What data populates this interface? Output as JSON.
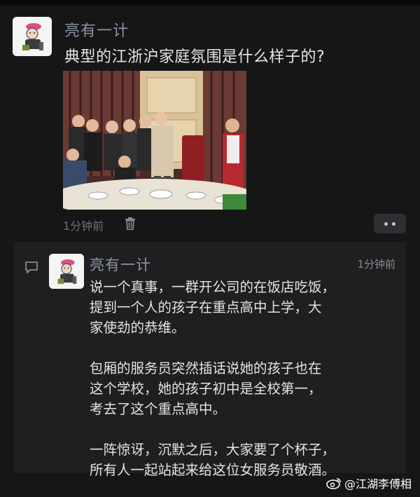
{
  "post": {
    "author": "亮有一计",
    "title": "典型的江浙沪家庭氛围是什么样子的?",
    "time": "1分钟前",
    "photo_alt_icon": "photo-image"
  },
  "reply": {
    "author": "亮有一计",
    "time": "1分钟前",
    "paragraphs": [
      "说一个真事，一群开公司的在饭店吃饭，\n提到一个人的孩子在重点高中上学，大\n家使劲的恭维。",
      "包厢的服务员突然插话说她的孩子也在\n这个学校，她的孩子初中是全校第一，\n考去了这个重点高中。",
      "一阵惊讶，沉默之后，大家要了个杯子，\n所有人一起站起来给这位女服务员敬酒。"
    ]
  },
  "watermark": {
    "text": "@江湖李傅相"
  },
  "icons": {
    "trash": "trash-icon",
    "more": "more-dots-icon",
    "comment": "comment-icon",
    "weibo": "weibo-logo"
  },
  "colors": {
    "background": "#161616",
    "panel": "#1f1f21",
    "author": "#8c93a6",
    "text": "#e6e6e6",
    "muted": "#6f7078"
  }
}
